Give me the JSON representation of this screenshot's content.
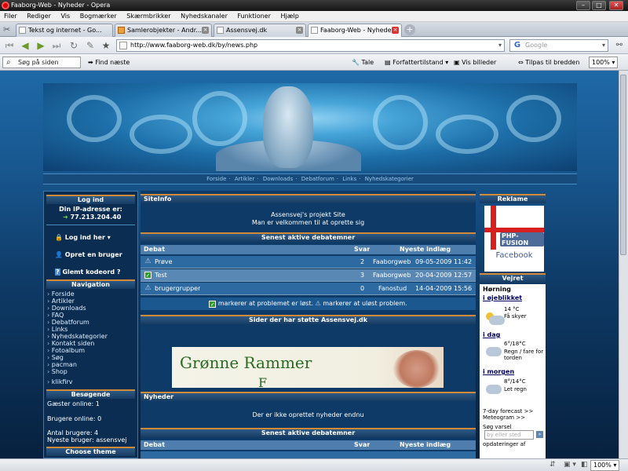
{
  "window": {
    "title": "Faaborg-Web - Nyheder - Opera"
  },
  "menu": [
    "Filer",
    "Rediger",
    "Vis",
    "Bogmærker",
    "Skærmbrikker",
    "Nyhedskanaler",
    "Funktioner",
    "Hjælp"
  ],
  "tabs": [
    {
      "label": "Tekst og internet - Go...",
      "active": false
    },
    {
      "label": "Samlerobjekter - Andr...",
      "active": false
    },
    {
      "label": "Assensvej.dk",
      "active": false
    },
    {
      "label": "Faaborg-Web - Nyheder",
      "active": true
    }
  ],
  "address": {
    "url": "http://www.faaborg-web.dk/by/news.php"
  },
  "search": {
    "placeholder": "Google"
  },
  "toolbar2": {
    "find_placeholder": "Søg på siden",
    "find_next": "Find næste",
    "speak": "Tale",
    "author_mode": "Forfattertilstand",
    "show_images": "Vis billeder",
    "fit_width": "Tilpas til bredden",
    "zoom": "100%"
  },
  "site": {
    "nav_links": [
      "Forside",
      "Artikler",
      "Downloads",
      "Debatforum",
      "Links",
      "Nyhedskategorier"
    ]
  },
  "left": {
    "login_title": "Log ind",
    "ip_label": "Din IP-adresse er:",
    "ip": "77.213.204.40",
    "login_link": "Log ind her",
    "register": "Opret en bruger",
    "forgot": "Glemt kodeord ?",
    "nav_title": "Navigation",
    "nav_items": [
      "Forside",
      "Artikler",
      "Downloads",
      "FAQ",
      "Debatforum",
      "Links",
      "Nyhedskategorier",
      "Kontakt siden",
      "Fotoalbum",
      "Søg",
      "pacman",
      "Shop",
      "klikfirv"
    ],
    "visitors_title": "Besøgende",
    "guests": "Gæster online: 1",
    "users_online": "Brugere online: 0",
    "user_count": "Antal brugere: 4",
    "newest": "Nyeste bruger: assensvej",
    "theme_title": "Choose theme"
  },
  "center": {
    "siteinfo_title": "SiteInfo",
    "siteinfo_line1": "Assensvej's projekt Site",
    "siteinfo_line2": "Man er velkommen til at oprette sig",
    "debates_title": "Senest aktive debatemner",
    "table_headers": {
      "topic": "Debat",
      "replies": "Svar",
      "latest": "Nyeste indlæg"
    },
    "rows": [
      {
        "topic": "Prøve",
        "replies": "2",
        "user": "Faaborgweb",
        "date": "09-05-2009 11:42",
        "solved": false
      },
      {
        "topic": "Test",
        "replies": "3",
        "user": "Faaborgweb",
        "date": "20-04-2009 12:57",
        "solved": true
      },
      {
        "topic": "brugergrupper",
        "replies": "0",
        "user": "Fanostud",
        "date": "14-04-2009 15:56",
        "solved": false
      }
    ],
    "legend_solved": "markerer at problemet er løst.",
    "legend_unsolved": "markerer at uløst problem.",
    "sponsors_title": "Sider der har støtte Assensvej.dk",
    "banner_text1": "Grønne Rammer",
    "banner_text2": "F",
    "news_title": "Nyheder",
    "no_news": "Der er ikke oprettet nyheder endnu",
    "debates2_title": "Senest aktive debatemner",
    "debate2_header": "Debat",
    "replies2_header": "Svar",
    "latest2_header": "Nyeste indlæg"
  },
  "right": {
    "ad_title": "Reklame",
    "ad_text": "Facebook",
    "ad_logo": "PHP-FUSION",
    "weather_title": "Vejret",
    "city": "Hørning",
    "now_label": "i øjeblikket",
    "now_temp": "14 °C",
    "now_desc": "Få skyer",
    "today_label": "i dag",
    "today_temp": "6°/18°C",
    "today_desc1": "Regn / fare for",
    "today_desc2": "torden",
    "tomorrow_label": "i morgen",
    "tomorrow_temp": "8°/14°C",
    "tomorrow_desc": "Let regn",
    "forecast_link": "7-day forecast >>",
    "meteogram_link": "Meteogram >>",
    "search_label": "Søg varsel",
    "search_placeholder": "by eller sted",
    "updates": "opdateringer af"
  },
  "status": {
    "zoom": "100%"
  }
}
